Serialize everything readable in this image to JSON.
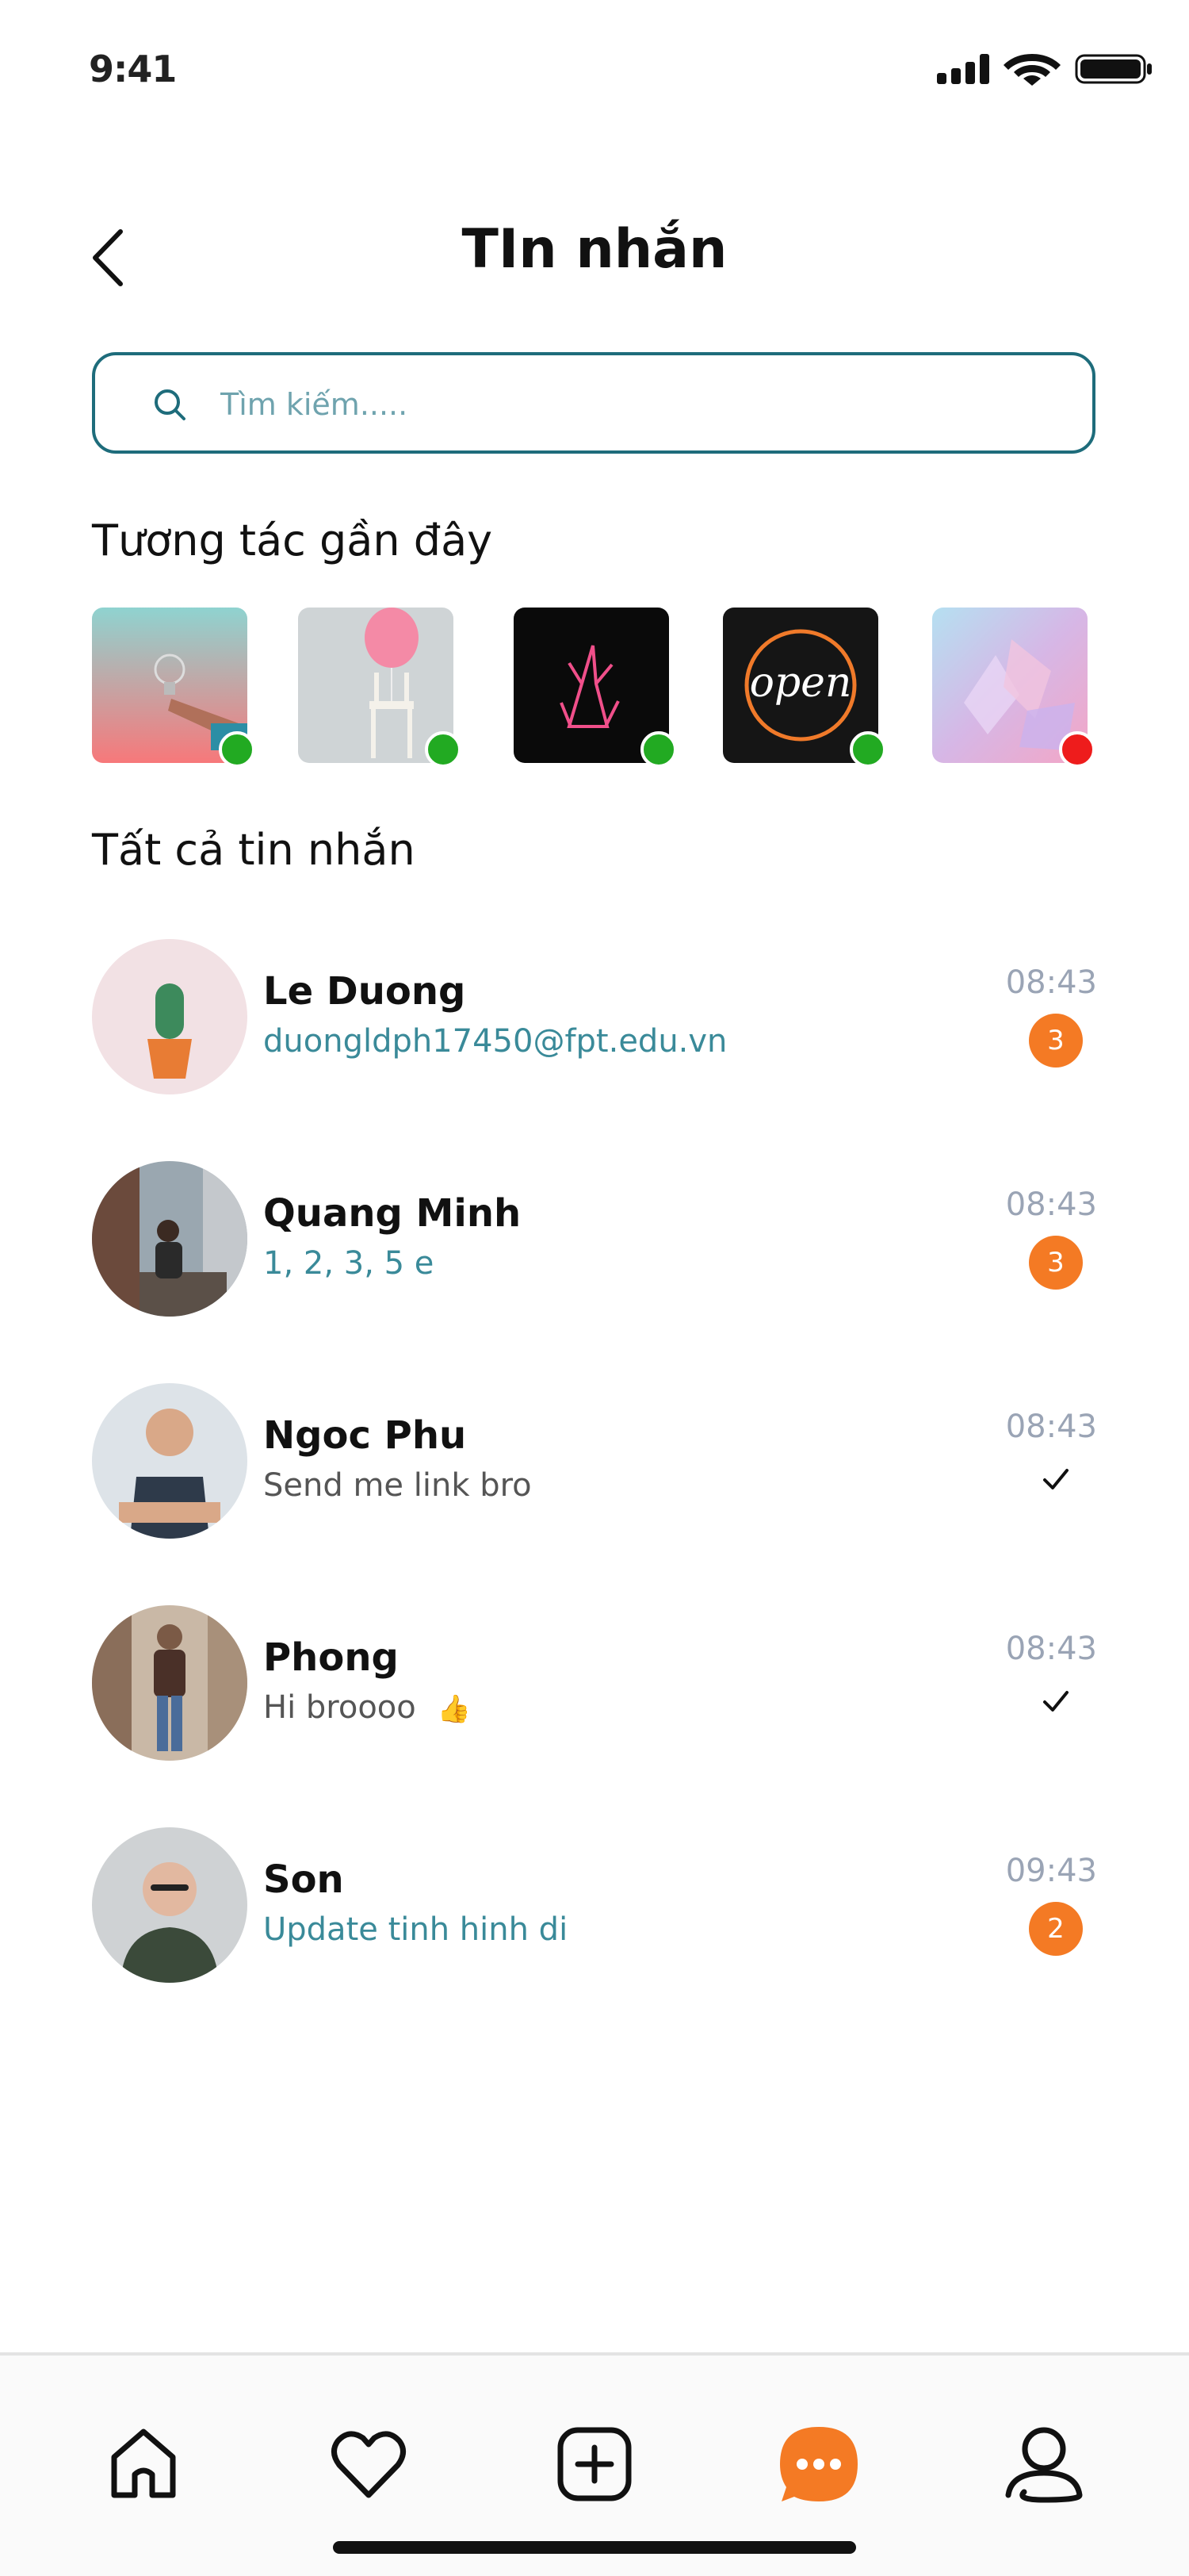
{
  "status_bar": {
    "time": "9:41"
  },
  "header": {
    "title": "TIn nhắn"
  },
  "search": {
    "placeholder": "Tìm kiếm....."
  },
  "recent": {
    "title": "Tương tác gần đây",
    "items": [
      {
        "image": "lightbulb-hand-image",
        "status": "online",
        "status_color": "#22aa22"
      },
      {
        "image": "balloon-chair-image",
        "status": "online",
        "status_color": "#22aa22"
      },
      {
        "image": "neon-praying-hands-image",
        "status": "online",
        "status_color": "#22aa22"
      },
      {
        "image": "neon-open-sign-image",
        "status": "online",
        "status_color": "#22aa22"
      },
      {
        "image": "crystals-image",
        "status": "offline",
        "status_color": "#ee1c1c"
      }
    ]
  },
  "messages": {
    "title": "Tất cả tin nhắn",
    "items": [
      {
        "name": "Le Duong",
        "preview": "duongldph17450@fpt.edu.vn",
        "time": "08:43",
        "unread": "3",
        "avatar": "cactus-avatar"
      },
      {
        "name": "Quang Minh",
        "preview": " 1, 2, 3, 5 e",
        "time": "08:43",
        "unread": "3",
        "avatar": "city-man-avatar"
      },
      {
        "name": "Ngoc Phu",
        "preview": "Send me link bro",
        "time": "08:43",
        "read": true,
        "avatar": "man-tank-top-avatar"
      },
      {
        "name": "Phong",
        "preview": "Hi broooo ",
        "emoji": "👍",
        "time": "08:43",
        "read": true,
        "avatar": "street-man-avatar"
      },
      {
        "name": "Son",
        "preview": "Update tinh hinh di",
        "time": "09:43",
        "unread": "2",
        "avatar": "bald-man-avatar"
      }
    ]
  },
  "bottom_nav": {
    "items": [
      "home-icon",
      "heart-icon",
      "add-post-icon",
      "messages-icon",
      "profile-icon"
    ],
    "active": "messages-icon",
    "accent": "#f47a24"
  },
  "colors": {
    "accent": "#f47a24",
    "teal": "#1e6c7b",
    "preview_teal": "#3a8a99",
    "time_gray": "#9aa4b5"
  }
}
